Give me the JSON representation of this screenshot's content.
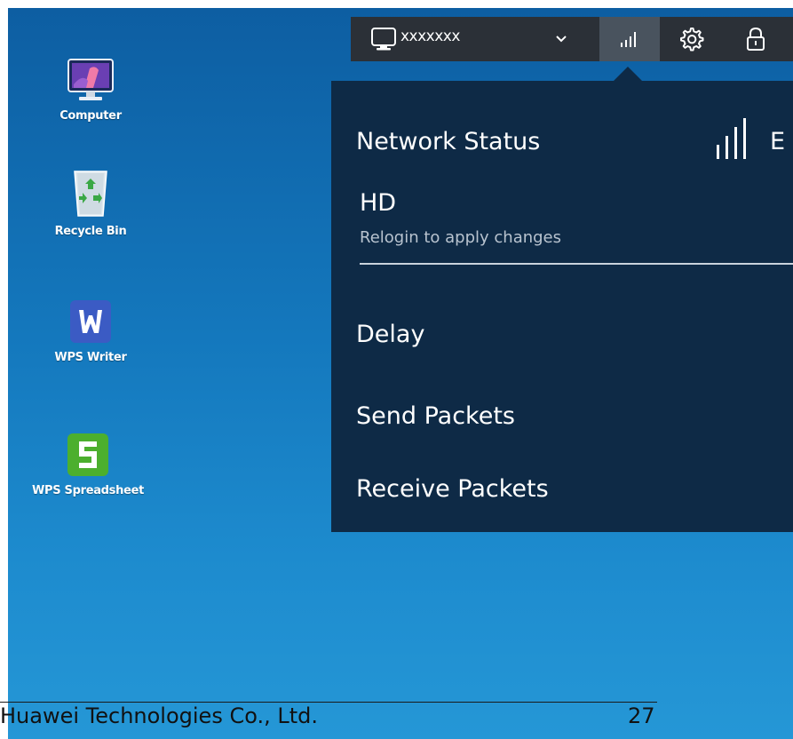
{
  "desktop": {
    "icons": [
      {
        "label": "Computer",
        "icon": "computer-icon"
      },
      {
        "label": "Recycle Bin",
        "icon": "recycle-bin-icon"
      },
      {
        "label": "WPS Writer",
        "icon": "wps-writer-icon"
      },
      {
        "label": "WPS Spreadsheet",
        "icon": "wps-spreadsheet-icon"
      }
    ]
  },
  "toolbar": {
    "machine_name": "xxxxxxx",
    "icons": [
      "monitor-icon",
      "chevron-down-icon",
      "signal-icon",
      "gear-icon",
      "lock-icon"
    ]
  },
  "network_panel": {
    "title": "Network Status",
    "quality_label": "E",
    "mode": "HD",
    "hint": "Relogin to apply changes",
    "rows": [
      {
        "label": "Delay"
      },
      {
        "label": "Send Packets"
      },
      {
        "label": "Receive Packets"
      }
    ]
  },
  "footer": {
    "company": "Huawei Technologies Co., Ltd.",
    "page_number": "27"
  },
  "colors": {
    "desktop_top": "#0d5ea2",
    "desktop_bottom": "#2597d6",
    "toolbar_bg": "#2b3037",
    "panel_bg": "#0e2a46",
    "wps_writer": "#3b5bc4",
    "wps_spreadsheet": "#4caf2e"
  }
}
